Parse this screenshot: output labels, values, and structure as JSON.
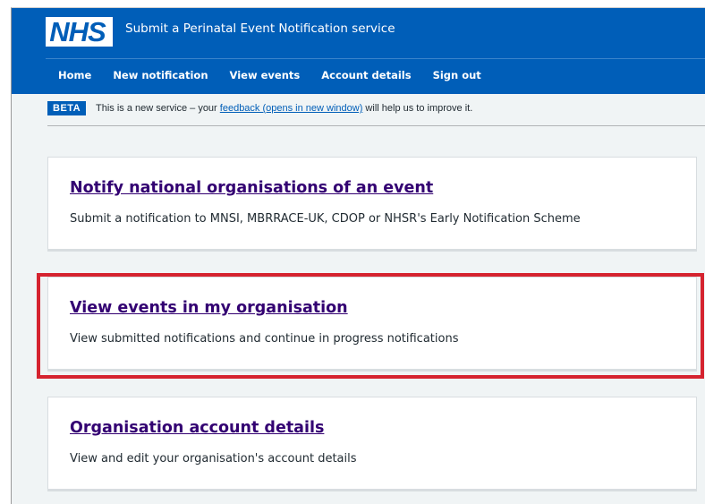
{
  "header": {
    "logo_text": "NHS",
    "service_name": "Submit a Perinatal Event Notification service",
    "nav": [
      {
        "label": "Home"
      },
      {
        "label": "New notification"
      },
      {
        "label": "View events"
      },
      {
        "label": "Account details"
      },
      {
        "label": "Sign out"
      }
    ]
  },
  "beta_banner": {
    "tag": "BETA",
    "text_before": "This is a new service – your ",
    "link_text": "feedback (opens in new window)",
    "text_after": " will help us to improve it."
  },
  "cards": [
    {
      "title": "Notify national organisations of an event",
      "description": "Submit a notification to MNSI, MBRRACE-UK, CDOP or NHSR's Early Notification Scheme"
    },
    {
      "title": "View events in my organisation",
      "description": "View submitted notifications and continue in progress notifications"
    },
    {
      "title": "Organisation account details",
      "description": "View and edit your organisation's account details"
    }
  ],
  "colors": {
    "header_blue": "#005eb8",
    "link_purple": "#330072",
    "highlight_red": "#d5232f",
    "page_background": "#f0f4f5"
  }
}
